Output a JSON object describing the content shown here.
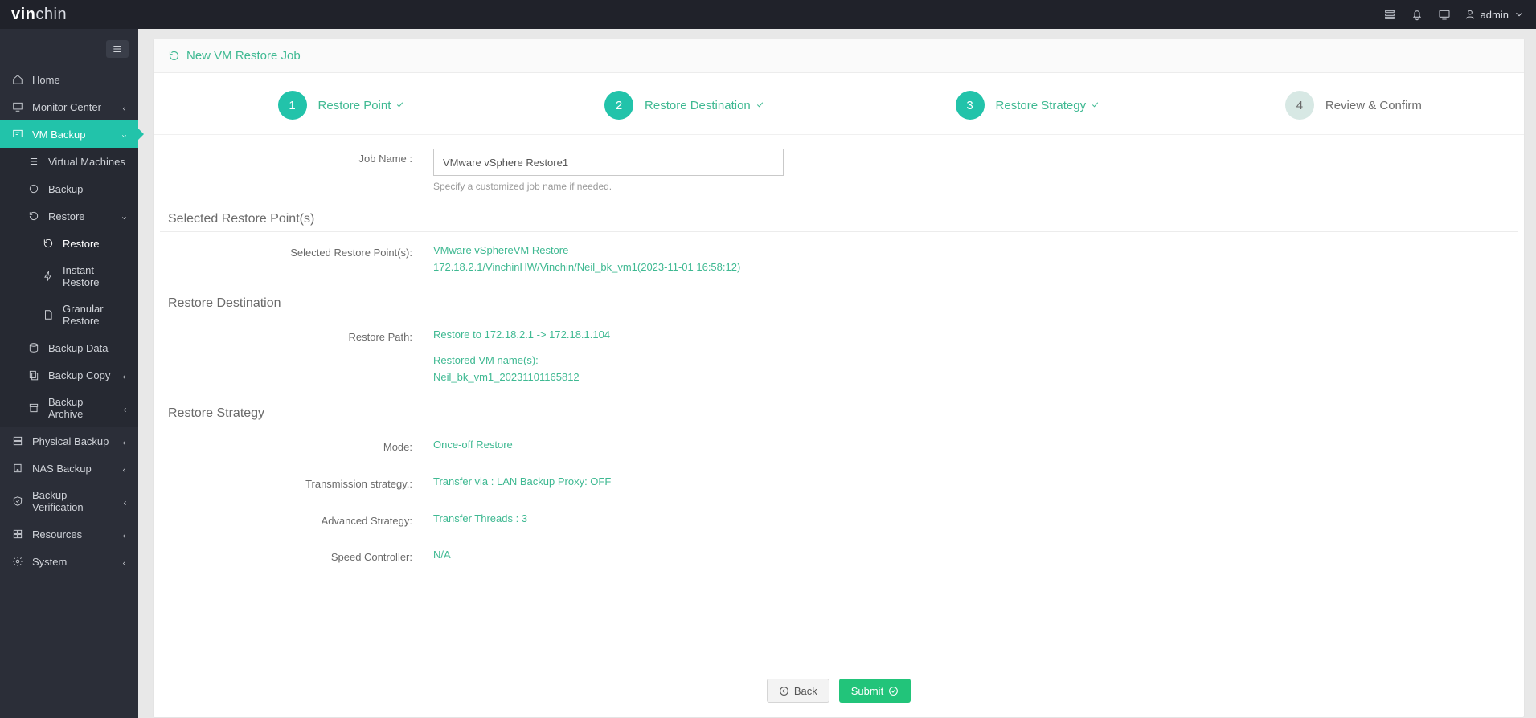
{
  "brand": {
    "part1": "vin",
    "part2": "chin"
  },
  "topbar": {
    "user_label": "admin"
  },
  "sidebar": {
    "home": "Home",
    "monitor": "Monitor Center",
    "vm_backup": "VM Backup",
    "vm_sub": {
      "vms": "Virtual Machines",
      "backup": "Backup",
      "restore": "Restore",
      "restore_sub": {
        "restore": "Restore",
        "instant": "Instant Restore",
        "granular": "Granular Restore"
      },
      "backup_data": "Backup Data",
      "backup_copy": "Backup Copy",
      "backup_archive": "Backup Archive"
    },
    "physical": "Physical Backup",
    "nas": "NAS Backup",
    "verification": "Backup Verification",
    "resources": "Resources",
    "system": "System"
  },
  "panel": {
    "title": "New VM Restore Job"
  },
  "steps": {
    "s1": "Restore Point",
    "s2": "Restore Destination",
    "s3": "Restore Strategy",
    "s4": "Review & Confirm"
  },
  "form": {
    "job_name_label": "Job Name :",
    "job_name_value": "VMware vSphere Restore1",
    "job_name_help": "Specify a customized job name if needed.",
    "sec_points": "Selected Restore Point(s)",
    "points_label": "Selected Restore Point(s):",
    "points_line1": "VMware vSphereVM Restore",
    "points_line2": "172.18.2.1/VinchinHW/Vinchin/Neil_bk_vm1(2023-11-01 16:58:12)",
    "sec_dest": "Restore Destination",
    "dest_path_label": "Restore Path:",
    "dest_path_value": "Restore to 172.18.2.1 -> 172.18.1.104",
    "dest_names_label": "Restored VM name(s):",
    "dest_names_value": "Neil_bk_vm1_20231101165812",
    "sec_strategy": "Restore Strategy",
    "mode_label": "Mode:",
    "mode_value": "Once-off Restore",
    "trans_label": "Transmission strategy.:",
    "trans_value": "Transfer via : LAN Backup Proxy: OFF",
    "adv_label": "Advanced Strategy:",
    "adv_value": "Transfer Threads : 3",
    "speed_label": "Speed Controller:",
    "speed_value": "N/A"
  },
  "buttons": {
    "back": "Back",
    "submit": "Submit"
  }
}
